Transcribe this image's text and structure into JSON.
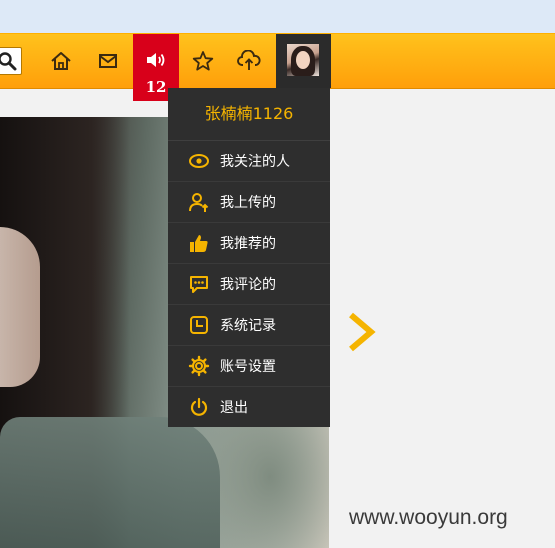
{
  "header": {
    "notification_count": "12",
    "icons": [
      "search-icon",
      "home-icon",
      "mail-icon",
      "speaker-icon",
      "star-icon",
      "upload-cloud-icon"
    ]
  },
  "user_menu": {
    "username": "张楠楠1126",
    "items": [
      {
        "label": "我关注的人",
        "icon": "eye-icon"
      },
      {
        "label": "我上传的",
        "icon": "user-upload-icon"
      },
      {
        "label": "我推荐的",
        "icon": "thumbs-up-icon"
      },
      {
        "label": "我评论的",
        "icon": "comment-icon"
      },
      {
        "label": "系统记录",
        "icon": "clock-log-icon"
      },
      {
        "label": "账号设置",
        "icon": "gear-icon"
      },
      {
        "label": "退出",
        "icon": "power-icon"
      }
    ]
  },
  "watermark": "www.wooyun.org",
  "colors": {
    "topbar": "#ffb414",
    "accent": "#f5b400",
    "notification": "#d8001a",
    "menu_bg": "#2e2e2e"
  }
}
